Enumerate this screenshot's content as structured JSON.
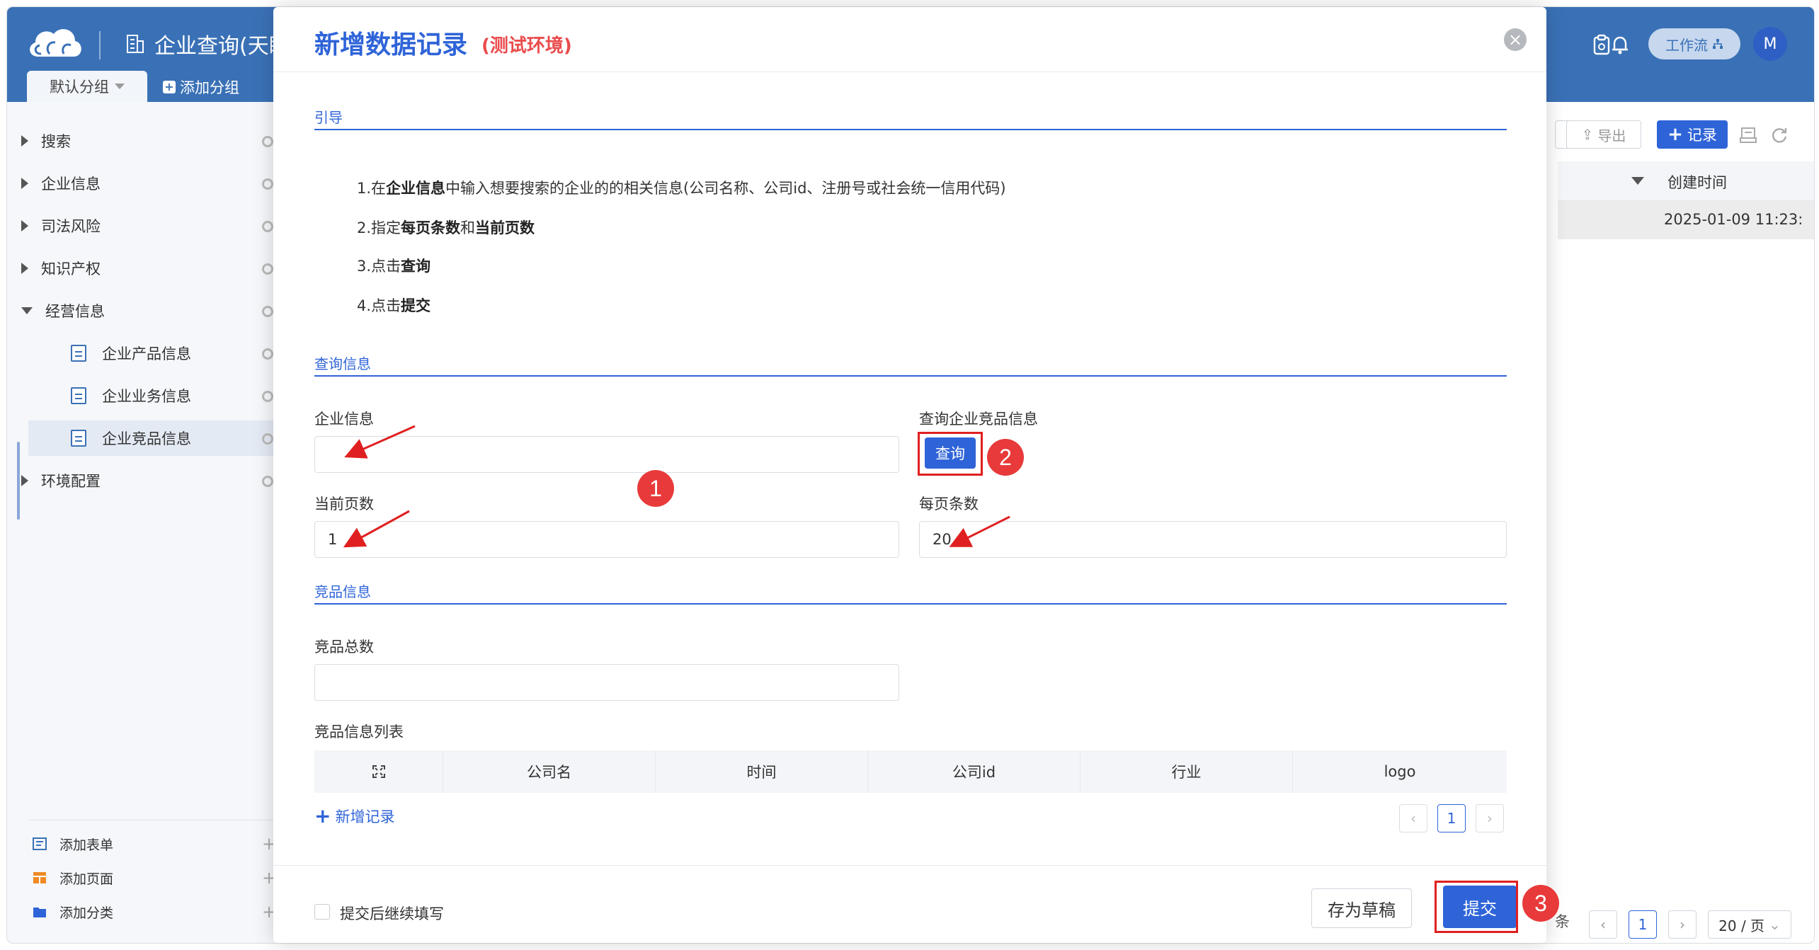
{
  "app": {
    "title": "企业查询(天眼",
    "default_group": "默认分组",
    "add_group": "添加分组",
    "workflow": "工作流",
    "avatar": "M"
  },
  "sidebar": {
    "items": [
      {
        "label": "搜索"
      },
      {
        "label": "企业信息"
      },
      {
        "label": "司法风险"
      },
      {
        "label": "知识产权"
      },
      {
        "label": "经营信息"
      },
      {
        "label": "企业产品信息"
      },
      {
        "label": "企业业务信息"
      },
      {
        "label": "企业竞品信息"
      },
      {
        "label": "环境配置"
      }
    ],
    "bottom": [
      {
        "label": "添加表单"
      },
      {
        "label": "添加页面"
      },
      {
        "label": "添加分类"
      }
    ]
  },
  "background": {
    "export": "导出",
    "record": "记录",
    "col_created": "创建时间",
    "row_created": "2025-01-09 11:23:",
    "footer_unit": "条",
    "page": "1",
    "page_size": "20 / 页"
  },
  "modal": {
    "title": "新增数据记录",
    "subtitle": "(测试环境)",
    "close": "×",
    "sections": {
      "guide": "引导",
      "query": "查询信息",
      "competitor": "竞品信息"
    },
    "guide": {
      "l1_pre": "1.在",
      "l1_bold": "企业信息",
      "l1_post": "中输入想要搜索的企业的的相关信息(公司名称、公司id、注册号或社会统一信用代码)",
      "l2_pre": "2.指定",
      "l2_b1": "每页条数",
      "l2_mid": "和",
      "l2_b2": "当前页数",
      "l3_pre": "3.点击",
      "l3_bold": "查询",
      "l4_pre": "4.点击",
      "l4_bold": "提交"
    },
    "fields": {
      "company_info": {
        "label": "企业信息",
        "value": ""
      },
      "query_label": "查询企业竞品信息",
      "query_button": "查询",
      "current_page": {
        "label": "当前页数",
        "value": "1"
      },
      "per_page": {
        "label": "每页条数",
        "value": "20"
      },
      "total": {
        "label": "竞品总数",
        "value": ""
      },
      "list_label": "竞品信息列表"
    },
    "table": {
      "columns": [
        "公司名",
        "时间",
        "公司id",
        "行业",
        "logo"
      ]
    },
    "add_record": "新增记录",
    "page": "1",
    "continue_label": "提交后继续填写",
    "draft": "存为草稿",
    "submit": "提交"
  },
  "annotations": {
    "badge1": "1",
    "badge2": "2",
    "badge3": "3"
  },
  "colors": {
    "primary": "#2f64d8",
    "header": "#3a71b6",
    "annotation_red": "#e02020",
    "subtitle_red": "#ea4c4c"
  }
}
